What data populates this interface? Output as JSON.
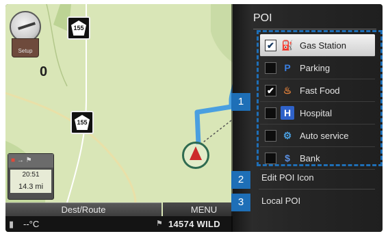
{
  "map": {
    "route_shield_label": "155",
    "route_number": "0",
    "compass_label": "Setup",
    "trip_time": "20:51",
    "trip_distance": "14.3 mi"
  },
  "bottom": {
    "dest_route_label": "Dest/Route",
    "menu_label": "MENU",
    "temperature": "--°C",
    "street": "14574 WILD"
  },
  "poi_panel": {
    "title": "POI",
    "items": [
      {
        "label": "Gas Station",
        "checked": true,
        "icon": "gas-pump-icon"
      },
      {
        "label": "Parking",
        "checked": false,
        "icon": "parking-icon"
      },
      {
        "label": "Fast Food",
        "checked": true,
        "icon": "fast-food-icon"
      },
      {
        "label": "Hospital",
        "checked": false,
        "icon": "hospital-icon"
      },
      {
        "label": "Auto service",
        "checked": false,
        "icon": "auto-service-icon"
      },
      {
        "label": "Bank",
        "checked": false,
        "icon": "bank-icon"
      }
    ],
    "edit_label": "Edit POI Icon",
    "local_label": "Local POI"
  },
  "callouts": [
    "1",
    "2",
    "3"
  ],
  "colors": {
    "highlight": "#1e6fb7",
    "route": "#4a9fe0",
    "map": "#d8e6b5"
  }
}
